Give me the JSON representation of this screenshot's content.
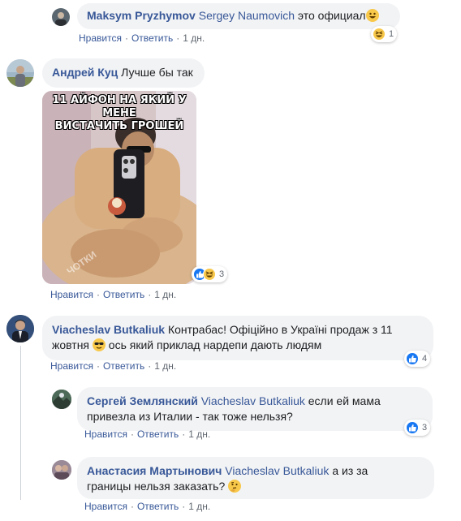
{
  "actions": {
    "like": "Нравится",
    "reply": "Ответить",
    "sep": "·"
  },
  "comments": [
    {
      "author": "Maksym Pryzhymov",
      "mention": "Sergey Naumovich",
      "text": "это официал",
      "emoji": "grinning-face",
      "time": "1 дн.",
      "reactions": {
        "icons": [
          "haha"
        ],
        "count": "1"
      }
    },
    {
      "author": "Андрей Куц",
      "mention": "",
      "text": "Лучше бы так",
      "time": "1 дн.",
      "meme": {
        "caption_line1": "11 АЙФОН НА ЯКИЙ У МЕНЕ",
        "caption_line2": "ВИСТАЧИТЬ ГРОШЕЙ",
        "watermark": "ЧОТКИ"
      },
      "reactions": {
        "icons": [
          "like",
          "haha"
        ],
        "count": "3"
      }
    },
    {
      "author": "Viacheslav Butkaliuk",
      "mention": "",
      "text_line1": "Контрабас! Офіційно в Україні продаж з 11",
      "text_line2_a": "жовтня",
      "text_line2_b": "ось який приклад нардепи дають людям",
      "emoji": "sunglasses-face",
      "time": "1 дн.",
      "reactions": {
        "icons": [
          "like"
        ],
        "count": "4"
      }
    },
    {
      "author": "Сергей Землянский",
      "mention": "Viacheslav Butkaliuk",
      "text_line1": "если ей мама",
      "text_line2": "привезла из Италии - так тоже нельзя?",
      "time": "1 дн.",
      "reactions": {
        "icons": [
          "like"
        ],
        "count": "3"
      }
    },
    {
      "author": "Анастасия Мартынович",
      "mention": "Viacheslav Butkaliuk",
      "text_line1": "а из за",
      "text_line2": "границы нельзя заказать?",
      "emoji": "thinking-face",
      "time": "1 дн."
    }
  ],
  "colors": {
    "link": "#385898",
    "bubble": "#f2f3f5",
    "meta": "#606770",
    "like": "#1877f2"
  }
}
